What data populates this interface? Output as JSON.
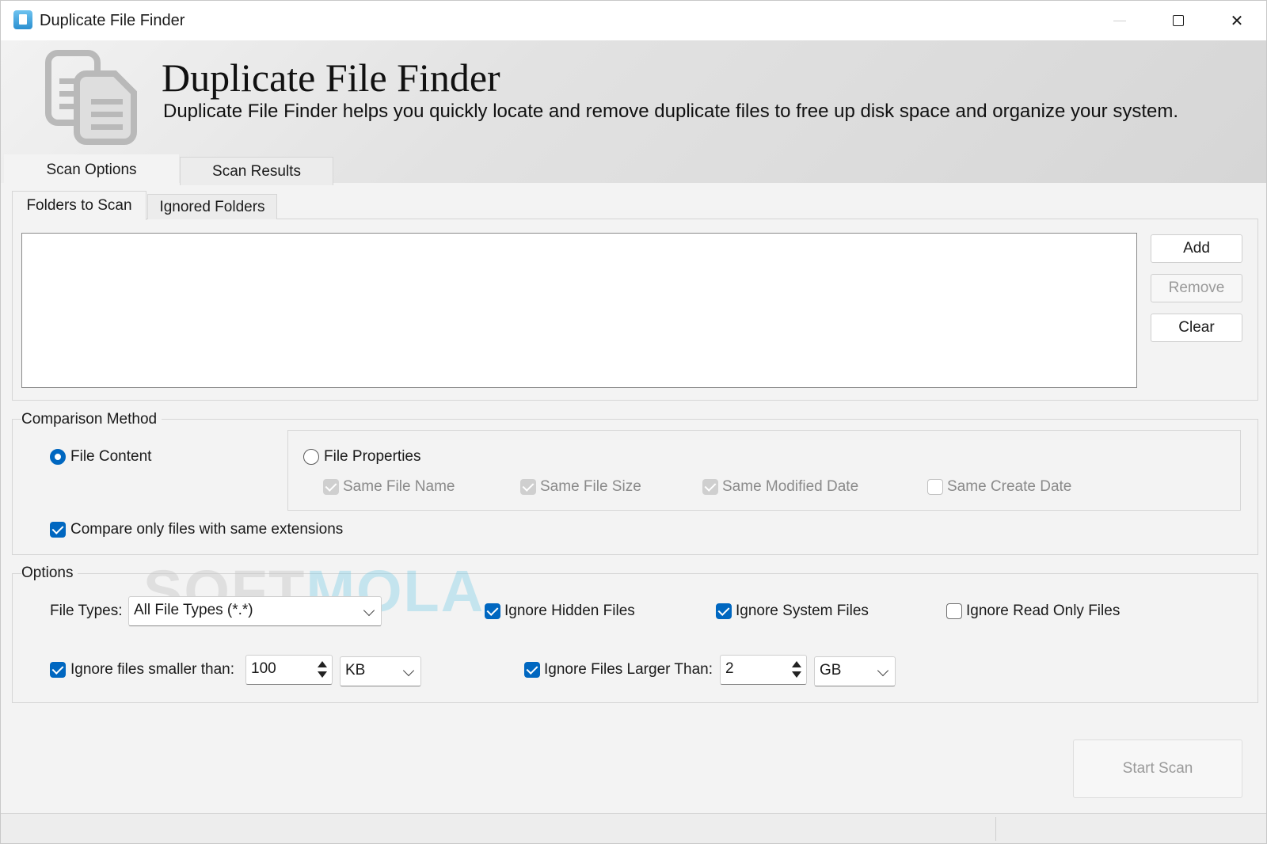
{
  "window": {
    "title": "Duplicate File Finder",
    "controls": [
      "minimize",
      "maximize",
      "close"
    ]
  },
  "banner": {
    "title": "Duplicate File Finder",
    "subtitle": "Duplicate File Finder helps you quickly locate and remove duplicate files to free up disk space and organize your system."
  },
  "main_tabs": [
    {
      "label": "Scan Options",
      "selected": true
    },
    {
      "label": "Scan Results",
      "selected": false
    }
  ],
  "sub_tabs": [
    {
      "label": "Folders to Scan",
      "selected": true
    },
    {
      "label": "Ignored Folders",
      "selected": false
    }
  ],
  "folders": {
    "items": [],
    "buttons": {
      "add": "Add",
      "remove": "Remove",
      "clear": "Clear"
    }
  },
  "comparison": {
    "label": "Comparison Method",
    "file_content": {
      "label": "File Content",
      "selected": true
    },
    "file_properties": {
      "label": "File Properties",
      "selected": false
    },
    "properties": [
      {
        "label": "Same File Name",
        "checked": true,
        "enabled": false
      },
      {
        "label": "Same File Size",
        "checked": true,
        "enabled": false
      },
      {
        "label": "Same Modified Date",
        "checked": true,
        "enabled": false
      },
      {
        "label": "Same Create Date",
        "checked": false,
        "enabled": false
      }
    ],
    "same_extensions": {
      "label": "Compare only files with same extensions",
      "checked": true
    }
  },
  "options": {
    "label": "Options",
    "file_types": {
      "label": "File Types:",
      "value": "All File Types (*.*)"
    },
    "ignore_hidden": {
      "label": "Ignore Hidden Files",
      "checked": true
    },
    "ignore_system": {
      "label": "Ignore System Files",
      "checked": true
    },
    "ignore_readonly": {
      "label": "Ignore Read Only Files",
      "checked": false
    },
    "smaller_than": {
      "label": "Ignore files smaller than:",
      "checked": true,
      "value": "100",
      "unit": "KB"
    },
    "larger_than": {
      "label": "Ignore Files Larger Than:",
      "checked": true,
      "value": "2",
      "unit": "GB"
    }
  },
  "start_button": "Start Scan",
  "watermark": {
    "part1": "SOFT",
    "part2": "MOLA"
  },
  "colors": {
    "accent": "#0067c0",
    "background": "#f3f3f3"
  }
}
